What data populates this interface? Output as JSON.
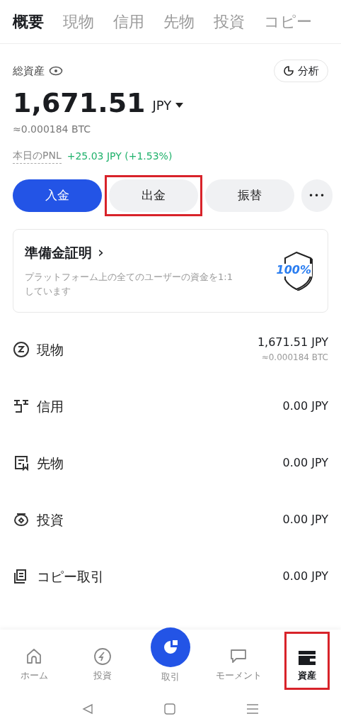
{
  "tabs": [
    {
      "label": "概要",
      "selected": true
    },
    {
      "label": "現物",
      "selected": false
    },
    {
      "label": "信用",
      "selected": false
    },
    {
      "label": "先物",
      "selected": false
    },
    {
      "label": "投資",
      "selected": false
    },
    {
      "label": "コピー",
      "selected": false
    }
  ],
  "summary": {
    "label": "総資産",
    "analysis_button": "分析",
    "amount": "1,671.51",
    "currency": "JPY",
    "btc": "≈0.000184 BTC",
    "pnl_label": "本日のPNL",
    "pnl_value": "+25.03 JPY (+1.53%)"
  },
  "actions": [
    {
      "kind": "primary",
      "label": "入金",
      "highlighted": false
    },
    {
      "kind": "secondary",
      "label": "出金",
      "highlighted": true
    },
    {
      "kind": "secondary",
      "label": "振替",
      "highlighted": false
    },
    {
      "kind": "more",
      "label": "•••",
      "highlighted": false
    }
  ],
  "reserve_card": {
    "title": "準備金証明",
    "chevron": "›",
    "lines": [
      "プラットフォーム上の全てのユーザーの資金を1:1",
      "しています"
    ],
    "badge": "100%"
  },
  "accounts": [
    {
      "kind": "spot",
      "name": "現物",
      "value": "1,671.51 JPY",
      "sub": "≈0.000184 BTC"
    },
    {
      "kind": "margin",
      "name": "信用",
      "value": "0.00 JPY"
    },
    {
      "kind": "futures",
      "name": "先物",
      "value": "0.00 JPY"
    },
    {
      "kind": "invest",
      "name": "投資",
      "value": "0.00 JPY"
    },
    {
      "kind": "copy",
      "name": "コピー取引",
      "value": "0.00 JPY"
    }
  ],
  "bottom_nav": [
    {
      "kind": "home",
      "label": "ホーム",
      "selected": false,
      "highlighted": false
    },
    {
      "kind": "invest",
      "label": "投資",
      "selected": false,
      "highlighted": false
    },
    {
      "kind": "trade",
      "label": "取引",
      "selected": false,
      "highlighted": false
    },
    {
      "kind": "moments",
      "label": "モーメント",
      "selected": false,
      "highlighted": false
    },
    {
      "kind": "assets",
      "label": "資産",
      "selected": true,
      "highlighted": true
    }
  ]
}
